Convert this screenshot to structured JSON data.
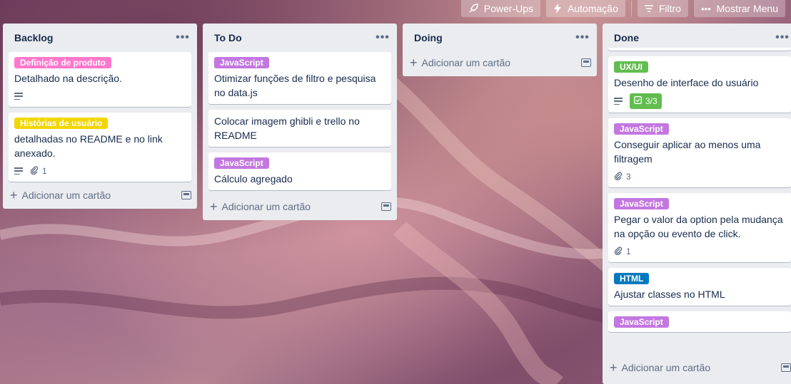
{
  "header": {
    "powerups": "Power-Ups",
    "automation": "Automação",
    "filter": "Filtro",
    "show_menu": "Mostrar Menu"
  },
  "colors": {
    "pink": "#ff78cb",
    "yellow": "#f2d600",
    "purple": "#c377e0",
    "green": "#61bd4f",
    "blue": "#0079bf"
  },
  "add_card_label": "Adicionar um cartão",
  "lists": {
    "backlog": {
      "title": "Backlog",
      "cards": [
        {
          "label": "Definição de produto",
          "title": "Detalhado na descrição."
        },
        {
          "label": "Histórias de usuário",
          "title": "detalhadas no README e no link anexado.",
          "attachments": "1"
        }
      ]
    },
    "todo": {
      "title": "To Do",
      "cards": [
        {
          "label": "JavaScript",
          "title": "Otimizar funções de filtro e pesquisa no data.js"
        },
        {
          "title": "Colocar imagem ghibli e trello no README"
        },
        {
          "label": "JavaScript",
          "title": "Cálculo agregado"
        }
      ]
    },
    "doing": {
      "title": "Doing",
      "cards": []
    },
    "done": {
      "title": "Done",
      "cards": [
        {
          "label": "UX/UI",
          "title": "Desenho de interface do usuário",
          "checklist": "3/3"
        },
        {
          "label": "JavaScript",
          "title": "Conseguir aplicar ao menos uma filtragem",
          "attachments": "3"
        },
        {
          "label": "JavaScript",
          "title": "Pegar o valor da option pela mudança na opção ou evento de click.",
          "attachments": "1"
        },
        {
          "label": "HTML",
          "title": "Ajustar classes no HTML"
        },
        {
          "label": "JavaScript",
          "title": ""
        }
      ]
    }
  }
}
